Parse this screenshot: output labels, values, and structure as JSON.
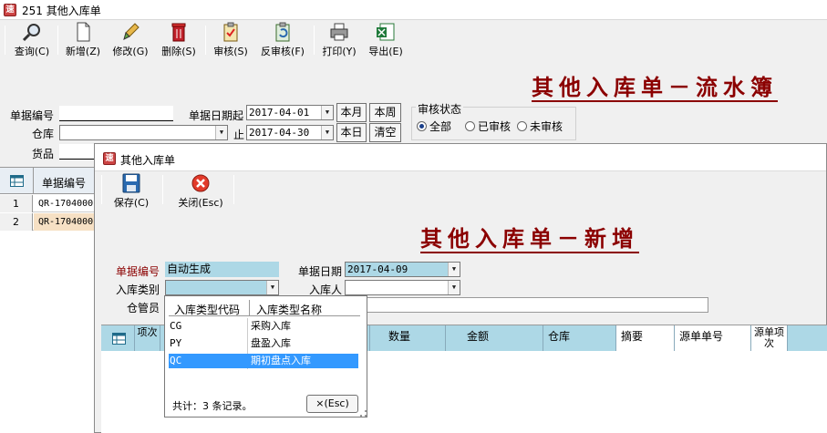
{
  "window": {
    "title": "251 其他入库单",
    "icon_text": "速"
  },
  "toolbar": [
    {
      "label": "查询(C)",
      "icon": "magnifier-icon"
    },
    {
      "label": "新增(Z)",
      "icon": "new-document-icon"
    },
    {
      "label": "修改(G)",
      "icon": "edit-brush-icon"
    },
    {
      "label": "删除(S)",
      "icon": "trash-icon"
    },
    {
      "label": "审核(S)",
      "icon": "clipboard-check-icon"
    },
    {
      "label": "反审核(F)",
      "icon": "clipboard-undo-icon"
    },
    {
      "label": "打印(Y)",
      "icon": "printer-icon"
    },
    {
      "label": "导出(E)",
      "icon": "excel-export-icon"
    }
  ],
  "main": {
    "title": "其他入库单－流水簿",
    "form": {
      "doc_no_label": "单据编号",
      "doc_no_value": "",
      "warehouse_label": "仓库",
      "warehouse_value": "",
      "goods_label": "货品",
      "date_from_label": "单据日期起",
      "date_from": "2017-04-01",
      "date_to_label": "止",
      "date_to": "2017-04-30",
      "btn_this_month": "本月",
      "btn_this_week": "本周",
      "btn_today": "本日",
      "btn_clear": "清空",
      "audit_group_label": "审核状态",
      "audit_options": [
        "全部",
        "已审核",
        "未审核"
      ],
      "audit_selected": "全部"
    },
    "grid": {
      "col_doc_no": "单据编号",
      "rows": [
        {
          "n": "1",
          "doc_no": "QR-1704000"
        },
        {
          "n": "2",
          "doc_no": "QR-1704000"
        }
      ]
    }
  },
  "dialog": {
    "title": "其他入库单",
    "icon_text": "速",
    "toolbar": [
      {
        "label": "保存(C)",
        "icon": "save-floppy-icon"
      },
      {
        "label": "关闭(Esc)",
        "icon": "close-circle-icon"
      }
    ],
    "heading": "其他入库单－新增",
    "form": {
      "doc_no_label": "单据编号",
      "doc_no_value": "自动生成",
      "doc_date_label": "单据日期",
      "doc_date_value": "2017-04-09",
      "type_label": "入库类别",
      "type_value": "",
      "person_label": "入库人",
      "person_value": "",
      "keeper_label": "仓管员"
    },
    "grid": {
      "columns": [
        "项次",
        "数量",
        "金额",
        "仓库",
        "摘要",
        "源单单号",
        "源单项次"
      ]
    },
    "popup": {
      "col_code": "入库类型代码",
      "col_name": "入库类型名称",
      "rows": [
        {
          "code": "CG",
          "name": "采购入库"
        },
        {
          "code": "PY",
          "name": "盘盈入库"
        },
        {
          "code": "QC",
          "name": "期初盘点入库"
        }
      ],
      "selected_index": 2,
      "footer": "共计：3 条记录。",
      "close_label": "×(Esc)"
    }
  }
}
